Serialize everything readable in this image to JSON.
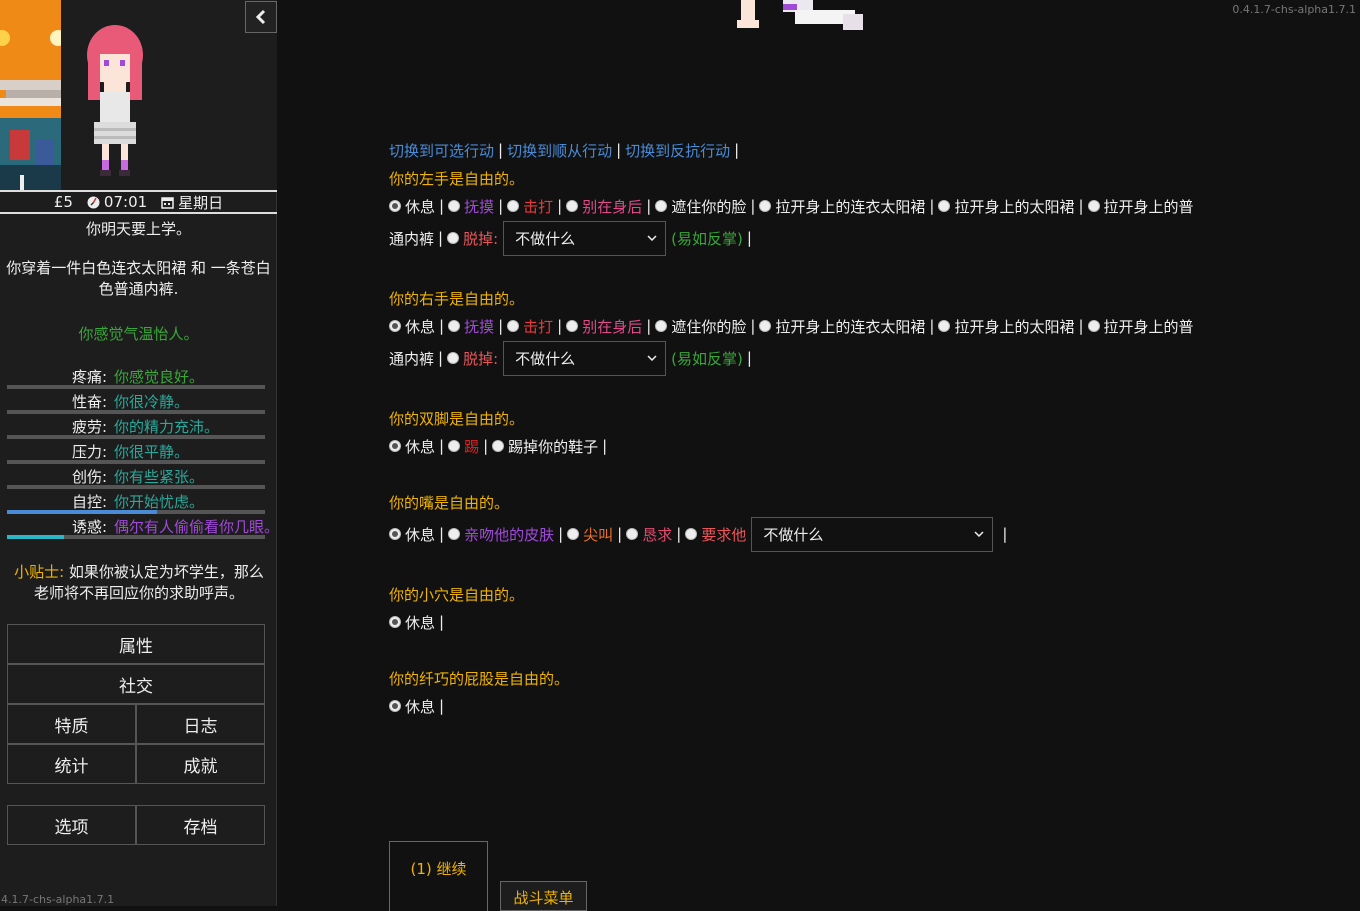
{
  "version": "0.4.1.7-chs-alpha1.7.1",
  "version_left": "4.1.7-chs-alpha1.7.1",
  "sidebar": {
    "money": "£5",
    "time": "07:01",
    "day": "星期日",
    "notice": "你明天要上学。",
    "clothing": "你穿着一件白色连衣太阳裙 和 一条苍白色普通内裤.",
    "mood": "你感觉气温怡人。",
    "stats": [
      {
        "label": "疼痛:",
        "value": "你感觉良好。",
        "color": "#38a838",
        "fill": 0.0,
        "bar_color": "#38a838"
      },
      {
        "label": "性奋:",
        "value": "你很冷静。",
        "color": "#2aa89a",
        "fill": 0.0,
        "bar_color": "#2aa89a"
      },
      {
        "label": "疲劳:",
        "value": "你的精力充沛。",
        "color": "#2aa89a",
        "fill": 0.0,
        "bar_color": "#2aa89a"
      },
      {
        "label": "压力:",
        "value": "你很平静。",
        "color": "#2aa89a",
        "fill": 0.0,
        "bar_color": "#2aa89a"
      },
      {
        "label": "创伤:",
        "value": "你有些紧张。",
        "color": "#2aa89a",
        "fill": 0.0,
        "bar_color": "#2aa89a"
      },
      {
        "label": "自控:",
        "value": "你开始忧虑。",
        "color": "#2aa89a",
        "fill": 0.58,
        "bar_color": "#4a8bd6"
      },
      {
        "label": "诱惑:",
        "value": "偶尔有人偷偷看你几眼。",
        "color": "#a04ad8",
        "fill": 0.22,
        "bar_color": "#2ab8c8"
      }
    ],
    "tip_label": "小贴士:",
    "tip_text": "如果你被认定为坏学生，那么老师将不再回应你的求助呼声。",
    "menu": {
      "attributes": "属性",
      "social": "社交",
      "traits": "特质",
      "journal": "日志",
      "statistics": "统计",
      "achievements": "成就",
      "options": "选项",
      "saves": "存档"
    }
  },
  "main": {
    "switch_links": [
      "切换到可选行动",
      "切换到顺从行动",
      "切换到反抗行动"
    ],
    "sections": {
      "left_hand": {
        "heading": "你的左手是自由的。",
        "opts": [
          "休息",
          "抚摸",
          "击打",
          "别在身后",
          "遮住你的脸",
          "拉开身上的连衣太阳裙",
          "拉开身上的太阳裙",
          "拉开身上的普通内裤"
        ],
        "opts_line2_prefix": "通内裤",
        "opt_line1_last": "拉开身上的普",
        "strip": "脱掉:",
        "select": "不做什么",
        "hint": "(易如反掌)"
      },
      "right_hand": {
        "heading": "你的右手是自由的。",
        "opts": [
          "休息",
          "抚摸",
          "击打",
          "别在身后",
          "遮住你的脸",
          "拉开身上的连衣太阳裙",
          "拉开身上的太阳裙",
          "拉开身上的普"
        ],
        "opts_line2_prefix": "通内裤",
        "strip": "脱掉:",
        "select": "不做什么",
        "hint": "(易如反掌)"
      },
      "feet": {
        "heading": "你的双脚是自由的。",
        "opts": [
          "休息",
          "踢",
          "踢掉你的鞋子"
        ]
      },
      "mouth": {
        "heading": "你的嘴是自由的。",
        "opts": [
          "休息",
          "亲吻他的皮肤",
          "尖叫",
          "恳求",
          "要求他"
        ],
        "select": "不做什么"
      },
      "vagina": {
        "heading": "你的小穴是自由的。",
        "opts": [
          "休息"
        ]
      },
      "butt": {
        "heading": "你的纤巧的屁股是自由的。",
        "opts": [
          "休息"
        ]
      }
    },
    "continue": "(1) 继续",
    "battle_menu": "战斗菜单"
  }
}
